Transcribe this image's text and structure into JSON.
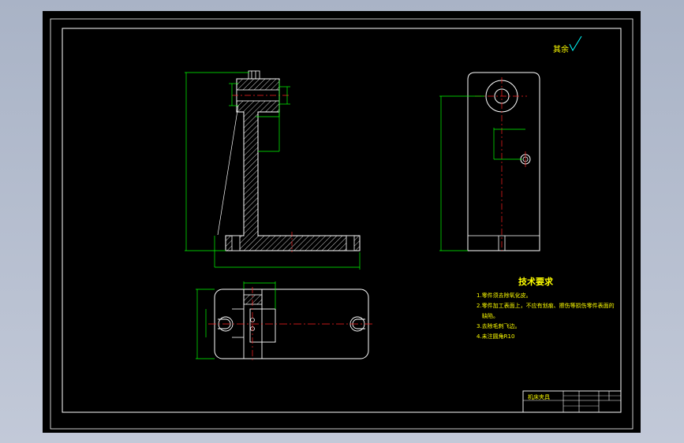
{
  "surface_finish": {
    "label": "其余"
  },
  "tech": {
    "title": "技术要求",
    "items": [
      "1.零件须去除氧化皮。",
      "2.零件加工表面上，不应有划痕、擦伤等损伤零件表面的",
      "缺陷。",
      "3.去除毛刺飞边。",
      "4.未注圆角R10"
    ]
  },
  "title_block": {
    "name": "机床夹具"
  },
  "colors": {
    "background": "#000000",
    "outline": "#ffffff",
    "dimension": "#00ff00",
    "centerline": "#ff2020",
    "annotation": "#ffff00",
    "surface_symbol": "#00ffff"
  }
}
